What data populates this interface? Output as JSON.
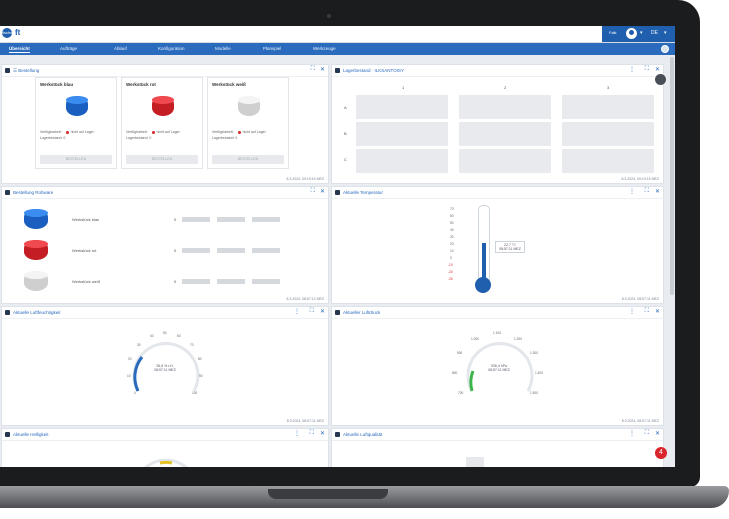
{
  "app": {
    "logo_text": "ft",
    "logo_mark": "fischer",
    "user_name": "Falk",
    "language": "DE"
  },
  "nav": {
    "items": [
      "Übersicht",
      "Aufträge",
      "Ablauf",
      "Konfiguration",
      "Modelle",
      "Planspiel",
      "Werkzeuge"
    ],
    "active": 0
  },
  "panels": {
    "order": {
      "title": "☰ Bestellung",
      "cards": [
        {
          "title": "Werkstück blau",
          "color": "#1f6fd6",
          "status_label": "Verfügbarkeit:",
          "status_value": "nicht auf Lager",
          "stock_label": "Lagerbestand:",
          "stock_value": "0",
          "button": "BESTELLEN"
        },
        {
          "title": "Werkstück rot",
          "color": "#e0262c",
          "status_label": "Verfügbarkeit:",
          "status_value": "nicht auf Lager",
          "stock_label": "Lagerbestand:",
          "stock_value": "0",
          "button": "BESTELLEN"
        },
        {
          "title": "Werkstück weiß",
          "color": "#e6e6e6",
          "status_label": "Verfügbarkeit:",
          "status_value": "nicht auf Lager",
          "stock_label": "Lagerbestand:",
          "stock_value": "0",
          "button": "BESTELLEN"
        }
      ],
      "timestamp": "8.3.2024, 09:19:15 MEZ"
    },
    "stock": {
      "title": "Lagerbestand · ILKSANTOISY",
      "columns": [
        "1",
        "2",
        "3"
      ],
      "rows": [
        "A",
        "B",
        "C"
      ],
      "timestamp": "8.3.2024, 09:19:15 MEZ"
    },
    "raw": {
      "title": "Bestellung Rohware",
      "rows": [
        {
          "label": "Werkstück blau",
          "count": "0",
          "color": "#1f6fd6"
        },
        {
          "label": "Werkstück rot",
          "count": "0",
          "color": "#e0262c"
        },
        {
          "label": "Werkstück weiß",
          "count": "0",
          "color": "#e6e6e6"
        }
      ],
      "timestamp": "8.3.2024, 08:57:12 MEZ"
    },
    "temp": {
      "title": "Aktuelle Temperatur",
      "scale": [
        "70",
        "60",
        "50",
        "40",
        "30",
        "20",
        "10",
        "0",
        "-10",
        "-20",
        "-30"
      ],
      "value": "22,7 °C",
      "sub": "08:57:11 MEZ",
      "timestamp": "8.3.2024, 08:57:11 MEZ"
    },
    "humidity": {
      "title": "Aktuelle Luftfeuchtigkeit",
      "scale": [
        "0",
        "10",
        "20",
        "30",
        "40",
        "50",
        "60",
        "70",
        "80",
        "90",
        "100"
      ],
      "value": "26,6 % r.H.",
      "sub": "08:57:11 MEZ",
      "timestamp": "8.3.2024, 08:57:11 MEZ"
    },
    "pressure": {
      "title": "Aktueller Luftdruck",
      "scale": [
        "700",
        "800",
        "900",
        "1.000",
        "1.100",
        "1.200",
        "1.300",
        "1.400",
        "1.500"
      ],
      "value": "926,4 hPa",
      "sub": "08:57:11 MEZ",
      "timestamp": "8.3.2024, 08:57:11 MEZ"
    },
    "brightness": {
      "title": "Aktuelle Helligkeit"
    },
    "airquality": {
      "title": "Aktuelle Luftqualität"
    }
  },
  "fab_label": "4"
}
